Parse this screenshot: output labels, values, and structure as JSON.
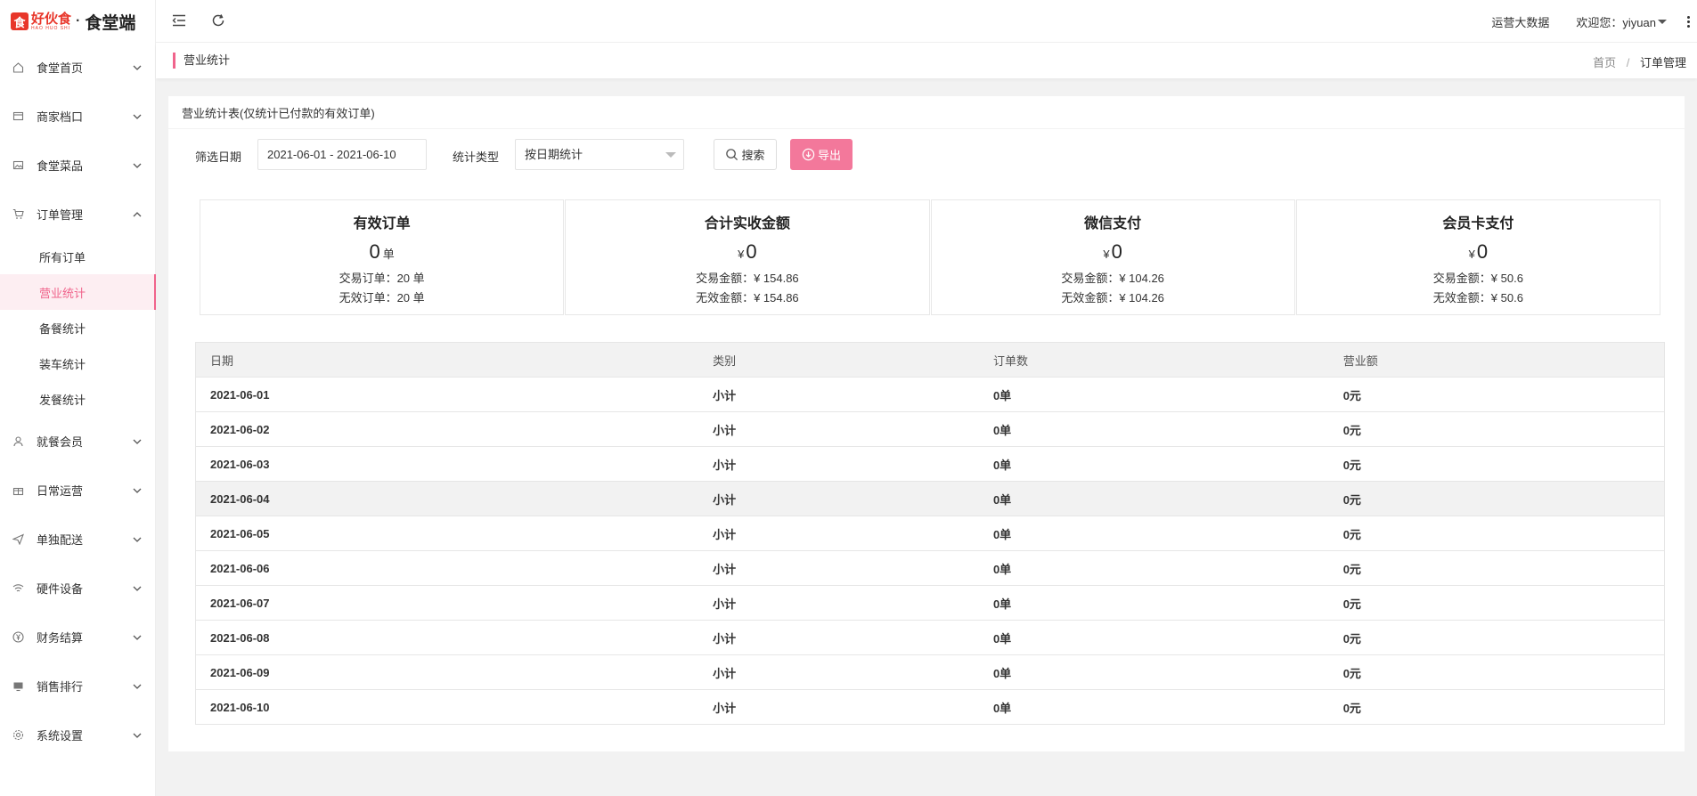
{
  "brand": {
    "mark": "食",
    "name": "好伙食",
    "name_sub": "HAO HUO SHI",
    "dot": "·",
    "app": "食堂端"
  },
  "sidebar": {
    "items": [
      {
        "label": "食堂首页",
        "icon": "home-icon"
      },
      {
        "label": "商家档口",
        "icon": "store-icon"
      },
      {
        "label": "食堂菜品",
        "icon": "image-icon"
      },
      {
        "label": "订单管理",
        "icon": "cart-icon",
        "expanded": true,
        "children": [
          {
            "label": "所有订单"
          },
          {
            "label": "营业统计",
            "active": true
          },
          {
            "label": "备餐统计"
          },
          {
            "label": "装车统计"
          },
          {
            "label": "发餐统计"
          }
        ]
      },
      {
        "label": "就餐会员",
        "icon": "users-icon"
      },
      {
        "label": "日常运营",
        "icon": "gift-icon"
      },
      {
        "label": "单独配送",
        "icon": "send-icon"
      },
      {
        "label": "硬件设备",
        "icon": "wifi-icon"
      },
      {
        "label": "财务结算",
        "icon": "yen-icon"
      },
      {
        "label": "销售排行",
        "icon": "monitor-icon"
      },
      {
        "label": "系统设置",
        "icon": "gear-icon"
      }
    ]
  },
  "topbar": {
    "data_link": "运营大数据",
    "welcome": "欢迎您：yiyuan"
  },
  "crumbbar": {
    "title": "营业统计",
    "home": "首页",
    "separator": "/",
    "current": "订单管理"
  },
  "card": {
    "title": "营业统计表(仅统计已付款的有效订单)"
  },
  "filters": {
    "date_label": "筛选日期",
    "date_value": "2021-06-01 - 2021-06-10",
    "type_label": "统计类型",
    "type_value": "按日期统计",
    "search_label": "搜索",
    "export_label": "导出"
  },
  "stats": [
    {
      "title": "有效订单",
      "value": "0",
      "unit": "单",
      "currency": "",
      "line1": "交易订单：20 单",
      "line2": "无效订单：20 单"
    },
    {
      "title": "合计实收金额",
      "value": "0",
      "unit": "",
      "currency": "¥",
      "line1": "交易金额：¥ 154.86",
      "line2": "无效金额：¥ 154.86"
    },
    {
      "title": "微信支付",
      "value": "0",
      "unit": "",
      "currency": "¥",
      "line1": "交易金额：¥ 104.26",
      "line2": "无效金额：¥ 104.26"
    },
    {
      "title": "会员卡支付",
      "value": "0",
      "unit": "",
      "currency": "¥",
      "line1": "交易金额：¥ 50.6",
      "line2": "无效金额：¥ 50.6"
    }
  ],
  "table": {
    "columns": [
      "日期",
      "类别",
      "订单数",
      "营业额"
    ],
    "rows": [
      [
        "2021-06-01",
        "小计",
        "0单",
        "0元"
      ],
      [
        "2021-06-02",
        "小计",
        "0单",
        "0元"
      ],
      [
        "2021-06-03",
        "小计",
        "0单",
        "0元"
      ],
      [
        "2021-06-04",
        "小计",
        "0单",
        "0元"
      ],
      [
        "2021-06-05",
        "小计",
        "0单",
        "0元"
      ],
      [
        "2021-06-06",
        "小计",
        "0单",
        "0元"
      ],
      [
        "2021-06-07",
        "小计",
        "0单",
        "0元"
      ],
      [
        "2021-06-08",
        "小计",
        "0单",
        "0元"
      ],
      [
        "2021-06-09",
        "小计",
        "0单",
        "0元"
      ],
      [
        "2021-06-10",
        "小计",
        "0单",
        "0元"
      ]
    ],
    "hover_row": 3
  },
  "colors": {
    "accent": "#f0648c",
    "export_button": "#f3789b",
    "brand_red": "#e8362a"
  }
}
